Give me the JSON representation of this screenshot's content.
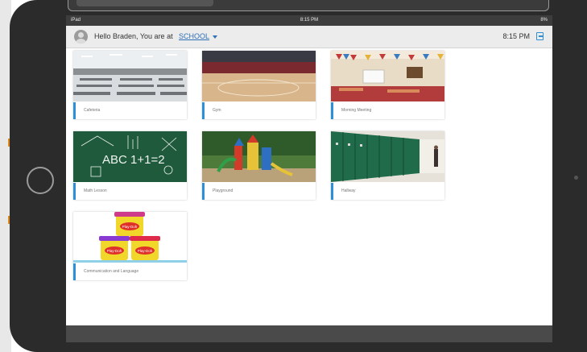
{
  "status_bar": {
    "device": "iPad",
    "time": "8:15 PM",
    "battery": "8%"
  },
  "header": {
    "greeting": "Hello Braden, You are at",
    "location": "SCHOOL",
    "clock": "8:15 PM"
  },
  "tiles": [
    {
      "label": "Cafeteria",
      "image": "cafeteria-photo"
    },
    {
      "label": "Gym",
      "image": "gym-photo"
    },
    {
      "label": "Morning Meeting",
      "image": "classroom-photo"
    },
    {
      "label": "Math Lesson",
      "image": "chalkboard-photo"
    },
    {
      "label": "Playground",
      "image": "playground-photo"
    },
    {
      "label": "Hallway",
      "image": "hallway-photo"
    },
    {
      "label": "Communication and Language",
      "image": "play-doh-photo"
    }
  ],
  "chalkboard_text": "ABC 1+1=2",
  "playdoh_brand": "Play-Doh",
  "colors": {
    "accent": "#2e8ed6",
    "link": "#2e6fb5",
    "status_bar": "#3d3d3d",
    "header_bg": "#ececec"
  }
}
